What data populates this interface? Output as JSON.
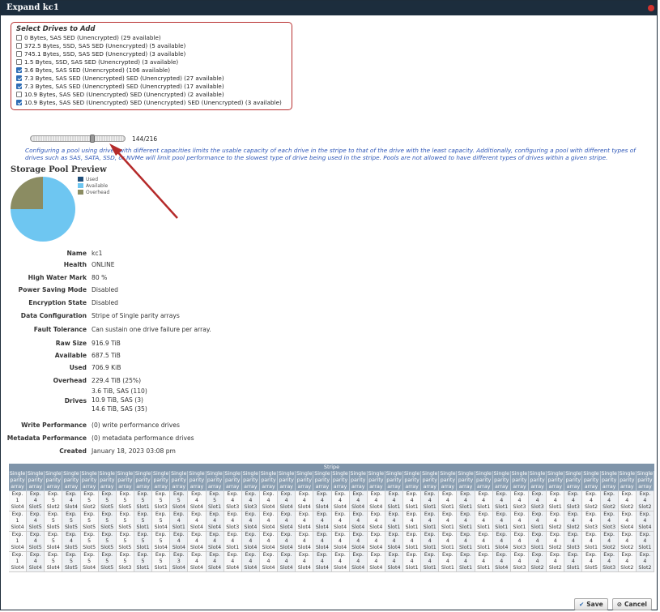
{
  "dialog": {
    "title": "Expand kc1"
  },
  "drive_select": {
    "header": "Select Drives to Add",
    "items": [
      {
        "label": "0 Bytes, SAS SED (Unencrypted) (29 available)",
        "checked": false
      },
      {
        "label": "372.5 Bytes, SSD, SAS SED (Unencrypted) (5 available)",
        "checked": false
      },
      {
        "label": "745.1 Bytes, SSD, SAS SED (Unencrypted) (3 available)",
        "checked": false
      },
      {
        "label": "1.5 Bytes, SSD, SAS SED (Unencrypted) (3 available)",
        "checked": false
      },
      {
        "label": "3.6 Bytes, SAS SED (Unencrypted) (106 available)",
        "checked": true
      },
      {
        "label": "7.3 Bytes, SAS SED (Unencrypted) SED (Unencrypted) (27 available)",
        "checked": true
      },
      {
        "label": "7.3 Bytes, SAS SED (Unencrypted) SED (Unencrypted) (17 available)",
        "checked": true
      },
      {
        "label": "10.9 Bytes, SAS SED (Unencrypted) SED (Unencrypted) (2 available)",
        "checked": false
      },
      {
        "label": "10.9 Bytes, SAS SED (Unencrypted) SED (Unencrypted) SED (Unencrypted) (3 available)",
        "checked": true
      }
    ]
  },
  "slider": {
    "value": 144,
    "max": 216,
    "label": "144/216"
  },
  "note": "Configuring a pool using drives with different capacities limits the usable capacity of each drive in the stripe to that of the drive with the least capacity. Additionally, configuring a pool with different types of drives such as SAS, SATA, SSD, or NVMe will limit pool performance to the slowest type of drive being used in the stripe. Pools are not allowed to have different types of drives within a given stripe.",
  "preview": {
    "title": "Storage Pool Preview",
    "legend": [
      {
        "label": "Used",
        "color": "#1f4e79"
      },
      {
        "label": "Available",
        "color": "#6ec6f1"
      },
      {
        "label": "Overhead",
        "color": "#8b8c62"
      }
    ],
    "pie": {
      "used": 0.0,
      "available": 687.5,
      "overhead": 229.4
    }
  },
  "props": [
    {
      "key": "Name",
      "value": "kc1"
    },
    {
      "key": "Health",
      "value": "ONLINE"
    },
    {
      "key": "High Water Mark",
      "value": "80 %"
    },
    {
      "key": "Power Saving Mode",
      "value": "Disabled"
    },
    {
      "key": "Encryption State",
      "value": "Disabled"
    },
    {
      "key": "Data Configuration",
      "value": "Stripe of Single parity arrays"
    },
    {
      "key": "Fault Tolerance",
      "value": "Can sustain one drive failure per array."
    },
    {
      "key": "Raw Size",
      "value": "916.9 TiB"
    },
    {
      "key": "Available",
      "value": "687.5 TiB"
    },
    {
      "key": "Used",
      "value": "706.9 KiB"
    },
    {
      "key": "Overhead",
      "value": "229.4 TiB (25%)"
    }
  ],
  "drives": {
    "key": "Drives",
    "lines": [
      "3.6 TiB, SAS (110)",
      "10.9 TiB, SAS (3)",
      "14.6 TiB, SAS (35)"
    ]
  },
  "props2": [
    {
      "key": "Write Performance",
      "value": "(0) write performance drives"
    },
    {
      "key": "Metadata Performance",
      "value": "(0) metadata performance drives"
    },
    {
      "key": "Created",
      "value": "January 18, 2023 03:08 pm"
    }
  ],
  "stripe": {
    "title": "Stripe",
    "column_header": "Single parity array",
    "rows": [
      [
        [
          "1",
          "4",
          "13"
        ],
        [
          "4",
          "5",
          "1"
        ],
        [
          "5",
          "2",
          "4"
        ],
        [
          "4",
          "4",
          "10"
        ],
        [
          "5",
          "2",
          "14"
        ],
        [
          "5",
          "5",
          "23"
        ],
        [
          "5",
          "5",
          "26"
        ],
        [
          "5",
          "1",
          "31"
        ],
        [
          "5",
          "3",
          "38"
        ],
        [
          "5",
          "4",
          "40"
        ],
        [
          "4",
          "4",
          "47"
        ],
        [
          "5",
          "1",
          "51"
        ],
        [
          "4",
          "3",
          "55"
        ],
        [
          "4",
          "3",
          "58"
        ],
        [
          "4",
          "4",
          "59"
        ],
        [
          "4",
          "4",
          "61"
        ],
        [
          "4",
          "4",
          "65"
        ],
        [
          "4",
          "4",
          "69"
        ],
        [
          "4",
          "4",
          "72"
        ],
        [
          "4",
          "4",
          "75"
        ],
        [
          "4",
          "4",
          "79"
        ],
        [
          "4",
          "1",
          "83"
        ],
        [
          "4",
          "1",
          "87"
        ],
        [
          "4",
          "1",
          "91"
        ],
        [
          "4",
          "1",
          "95"
        ],
        [
          "4",
          "1",
          "99"
        ],
        [
          "4",
          "1",
          "103"
        ],
        [
          "4",
          "1",
          "107"
        ],
        [
          "4",
          "3",
          "41"
        ],
        [
          "4",
          "3",
          "6"
        ],
        [
          "4",
          "1",
          "9"
        ],
        [
          "4",
          "3",
          "13"
        ],
        [
          "4",
          "2",
          "17"
        ],
        [
          "4",
          "2",
          "19"
        ],
        [
          "4",
          "2",
          "22"
        ],
        [
          "4",
          "2",
          "25"
        ],
        [
          "4",
          "2",
          "27"
        ]
      ],
      [
        [
          "1",
          "4",
          "16"
        ],
        [
          "4",
          "5",
          "2"
        ],
        [
          "5",
          "5",
          "5"
        ],
        [
          "5",
          "5",
          "10"
        ],
        [
          "5",
          "5",
          "14"
        ],
        [
          "5",
          "5",
          "24"
        ],
        [
          "5",
          "5",
          "27"
        ],
        [
          "5",
          "1",
          "32"
        ],
        [
          "5",
          "4",
          "36"
        ],
        [
          "4",
          "1",
          "48"
        ],
        [
          "4",
          "4",
          "52"
        ],
        [
          "4",
          "4",
          "55"
        ],
        [
          "4",
          "3",
          "58"
        ],
        [
          "4",
          "4",
          "59"
        ],
        [
          "4",
          "4",
          "62"
        ],
        [
          "4",
          "4",
          "66"
        ],
        [
          "4",
          "4",
          "70"
        ],
        [
          "4",
          "4",
          "73"
        ],
        [
          "4",
          "4",
          "76"
        ],
        [
          "4",
          "4",
          "80"
        ],
        [
          "4",
          "4",
          "84"
        ],
        [
          "4",
          "1",
          "88"
        ],
        [
          "4",
          "1",
          "92"
        ],
        [
          "4",
          "1",
          "96"
        ],
        [
          "4",
          "1",
          "100"
        ],
        [
          "4",
          "1",
          "104"
        ],
        [
          "4",
          "1",
          "108"
        ],
        [
          "4",
          "1",
          "3"
        ],
        [
          "4",
          "1",
          "7"
        ],
        [
          "4",
          "1",
          "9"
        ],
        [
          "4",
          "2",
          "14"
        ],
        [
          "4",
          "2",
          "17"
        ],
        [
          "4",
          "3",
          "19"
        ],
        [
          "4",
          "3",
          "22"
        ],
        [
          "4",
          "4",
          "26"
        ],
        [
          "4",
          "4",
          "27"
        ]
      ],
      [
        [
          "1",
          "4",
          "35"
        ],
        [
          "4",
          "5",
          "3"
        ],
        [
          "5",
          "4",
          "8"
        ],
        [
          "4",
          "5",
          "11"
        ],
        [
          "5",
          "5",
          "19"
        ],
        [
          "5",
          "5",
          "25"
        ],
        [
          "5",
          "5",
          "28"
        ],
        [
          "5",
          "1",
          "33"
        ],
        [
          "5",
          "4",
          "39"
        ],
        [
          "4",
          "4",
          "46"
        ],
        [
          "4",
          "4",
          "49"
        ],
        [
          "4",
          "4",
          "53"
        ],
        [
          "4",
          "1",
          "56"
        ],
        [
          "4",
          "4",
          "58"
        ],
        [
          "4",
          "4",
          "60"
        ],
        [
          "4",
          "4",
          "63"
        ],
        [
          "4",
          "4",
          "67"
        ],
        [
          "4",
          "4",
          "71"
        ],
        [
          "4",
          "4",
          "74"
        ],
        [
          "4",
          "4",
          "77"
        ],
        [
          "4",
          "4",
          "81"
        ],
        [
          "4",
          "4",
          "85"
        ],
        [
          "4",
          "1",
          "89"
        ],
        [
          "4",
          "1",
          "93"
        ],
        [
          "4",
          "1",
          "97"
        ],
        [
          "4",
          "1",
          "101"
        ],
        [
          "4",
          "1",
          "105"
        ],
        [
          "4",
          "4",
          "16"
        ],
        [
          "4",
          "3",
          "3"
        ],
        [
          "4",
          "1",
          "8"
        ],
        [
          "4",
          "2",
          "10"
        ],
        [
          "4",
          "3",
          "14"
        ],
        [
          "4",
          "1",
          "18"
        ],
        [
          "4",
          "2",
          "21"
        ],
        [
          "4",
          "2",
          "24"
        ],
        [
          "4",
          "1",
          "26"
        ],
        [
          "4",
          "1",
          "29"
        ]
      ],
      [
        [
          "1",
          "4",
          "36"
        ],
        [
          "4",
          "4",
          "4"
        ],
        [
          "5",
          "4",
          "9"
        ],
        [
          "5",
          "5",
          "13"
        ],
        [
          "5",
          "4",
          "19"
        ],
        [
          "5",
          "5",
          "26"
        ],
        [
          "5",
          "3",
          "30"
        ],
        [
          "5",
          "1",
          "37"
        ],
        [
          "5",
          "1",
          "39"
        ],
        [
          "3",
          "4",
          "47"
        ],
        [
          "4",
          "4",
          "50"
        ],
        [
          "4",
          "4",
          "54"
        ],
        [
          "4",
          "4",
          "57"
        ],
        [
          "4",
          "4",
          "59"
        ],
        [
          "4",
          "4",
          "60"
        ],
        [
          "4",
          "4",
          "64"
        ],
        [
          "4",
          "4",
          "68"
        ],
        [
          "4",
          "4",
          "71"
        ],
        [
          "4",
          "4",
          "75"
        ],
        [
          "4",
          "4",
          "78"
        ],
        [
          "4",
          "4",
          "82"
        ],
        [
          "4",
          "4",
          "86"
        ],
        [
          "4",
          "1",
          "90"
        ],
        [
          "4",
          "1",
          "94"
        ],
        [
          "4",
          "1",
          "98"
        ],
        [
          "4",
          "1",
          "102"
        ],
        [
          "4",
          "1",
          "106"
        ],
        [
          "4",
          "4",
          "18"
        ],
        [
          "4",
          "3",
          "5"
        ],
        [
          "4",
          "2",
          "8"
        ],
        [
          "4",
          "2",
          "11"
        ],
        [
          "4",
          "1",
          "16"
        ],
        [
          "4",
          "5",
          "19"
        ],
        [
          "4",
          "3",
          "21"
        ],
        [
          "4",
          "2",
          "26"
        ],
        [
          "4",
          "2",
          "27"
        ],
        [
          "4",
          "4",
          "29"
        ]
      ]
    ]
  },
  "buttons": {
    "save": "Save",
    "cancel": "Cancel"
  }
}
